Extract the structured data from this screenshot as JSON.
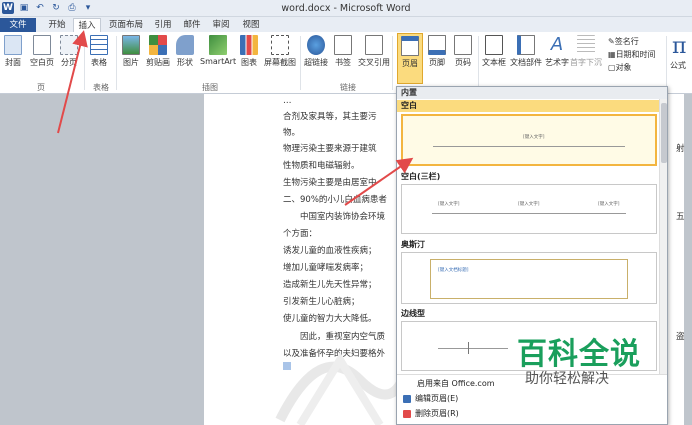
{
  "window": {
    "title": "word.docx - Microsoft Word"
  },
  "tabs": [
    "文件",
    "开始",
    "插入",
    "页面布局",
    "引用",
    "邮件",
    "审阅",
    "视图"
  ],
  "ribbon": {
    "pages_group": {
      "label": "页",
      "buttons": [
        "封面",
        "空白页",
        "分页"
      ]
    },
    "table_group": {
      "label": "表格",
      "buttons": [
        "表格"
      ]
    },
    "illustrations_group": {
      "label": "插图",
      "buttons": [
        "图片",
        "剪贴画",
        "形状",
        "SmartArt",
        "图表",
        "屏幕截图"
      ]
    },
    "links_group": {
      "label": "链接",
      "buttons": [
        "超链接",
        "书签",
        "交叉引用"
      ]
    },
    "header_buttons": [
      "页眉",
      "页脚",
      "页码"
    ],
    "text_buttons": [
      "文本框",
      "文档部件",
      "艺术字",
      "首字下沉"
    ],
    "text_small": [
      "签名行",
      "日期和时间",
      "对象"
    ],
    "symbol_buttons": [
      "公式"
    ]
  },
  "document": {
    "lines": [
      "合剂及家具等，其主要污",
      "物。",
      "物理污染主要来源于建筑",
      "性物质和电磁辐射。",
      "生物污染主要是由居室中",
      "二、90%的小儿白血病患者",
      "中国室内装饰协会环境",
      "个方面：",
      "诱发儿童的血液性疾病；",
      "增加儿童哮喘发病率；",
      "造成新生儿先天性异常；",
      "引发新生儿心脏病；",
      "使儿童的智力大大降低。",
      "因此，重视室内空气质",
      "以及准备怀孕的夫妇要格外"
    ],
    "right_fragments": [
      "射",
      "五",
      "盗"
    ]
  },
  "header_menu": {
    "title": "内置",
    "sections": [
      {
        "name": "空白",
        "placeholders": [
          "[键入文字]"
        ]
      },
      {
        "name": "空白(三栏)",
        "placeholders": [
          "[键入文字]",
          "[键入文字]",
          "[键入文字]"
        ]
      },
      {
        "name": "奥斯汀",
        "placeholders": [
          "[键入文档标题]"
        ]
      },
      {
        "name": "边线型",
        "placeholders": []
      }
    ],
    "items": [
      "启用来自 Office.com",
      "编辑页眉(E)",
      "删除页眉(R)"
    ]
  },
  "watermark": {
    "title": "百科全说",
    "subtitle": "助你轻松解决"
  },
  "colors": {
    "accent": "#2b579a",
    "selection": "#fbdb7e",
    "arrow": "#e24a4a",
    "watermark": "#1a9f5c"
  }
}
